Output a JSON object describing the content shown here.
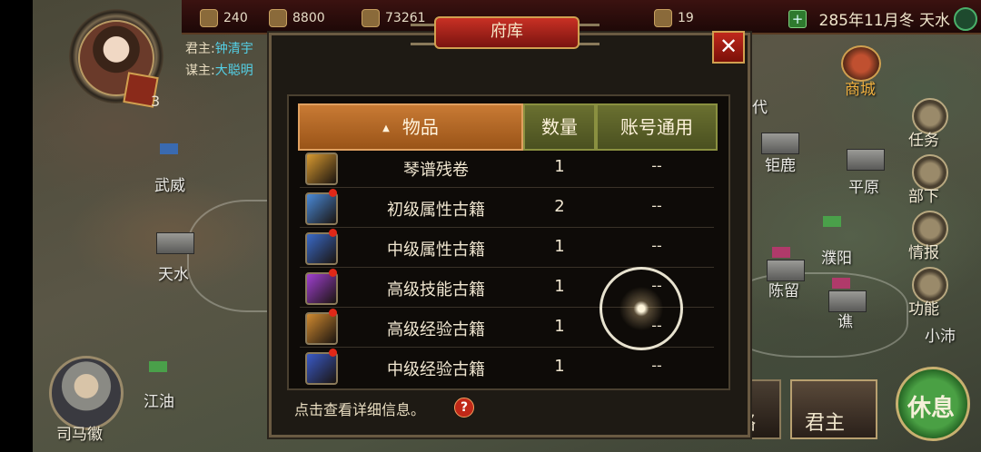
{
  "resources": [
    {
      "icon": "gold-coin-icon",
      "value": "240"
    },
    {
      "icon": "food-sack-icon",
      "value": "8800"
    },
    {
      "icon": "wood-icon",
      "value": "73261"
    },
    {
      "icon": "book-icon",
      "value": "19"
    }
  ],
  "date": "285年11月冬 天水",
  "lord": {
    "label_lord": "君主:",
    "lord_name": "钟清宇",
    "label_adviser": "谋主:",
    "adviser_name": "大聪明",
    "level": "3"
  },
  "map_cities": {
    "wuwei": "武威",
    "tianshui": "天水",
    "jiangyou": "江油",
    "dai": "代",
    "julu": "钜鹿",
    "pingyuan": "平原",
    "puyang": "濮阳",
    "chenliu": "陈留",
    "qiao": "谯",
    "xiaopei": "小沛",
    "shop": "商城"
  },
  "right_menu": {
    "tasks": "任务",
    "subordinates": "部下",
    "intel": "情报",
    "functions": "功能"
  },
  "bottom": {
    "advisor_name": "司马徽",
    "lord_button": "君主",
    "partial_button": "略",
    "rest_button": "休息"
  },
  "dialog": {
    "title": "府库",
    "close": "✕",
    "columns": {
      "items": "物品",
      "qty": "数量",
      "account": "账号通用"
    },
    "sort_arrow": "▲",
    "rows": [
      {
        "name": "琴谱残卷",
        "qty": "1",
        "account": "--",
        "icon": "scroll-score-icon",
        "color": "#d89a30",
        "new": false
      },
      {
        "name": "初级属性古籍",
        "qty": "2",
        "account": "--",
        "icon": "blue-scroll-icon",
        "color": "#4a8ad8",
        "new": true
      },
      {
        "name": "中级属性古籍",
        "qty": "1",
        "account": "--",
        "icon": "blue-scroll-icon",
        "color": "#3a6ac8",
        "new": true
      },
      {
        "name": "高级技能古籍",
        "qty": "1",
        "account": "--",
        "icon": "purple-scroll-icon",
        "color": "#a040d0",
        "new": true
      },
      {
        "name": "高级经验古籍",
        "qty": "1",
        "account": "--",
        "icon": "gold-scroll-icon",
        "color": "#d08a30",
        "new": true
      },
      {
        "name": "中级经验古籍",
        "qty": "1",
        "account": "--",
        "icon": "blue-scroll-icon",
        "color": "#3a5ac8",
        "new": true
      }
    ],
    "hint": "点击查看详细信息。",
    "help": "?"
  }
}
